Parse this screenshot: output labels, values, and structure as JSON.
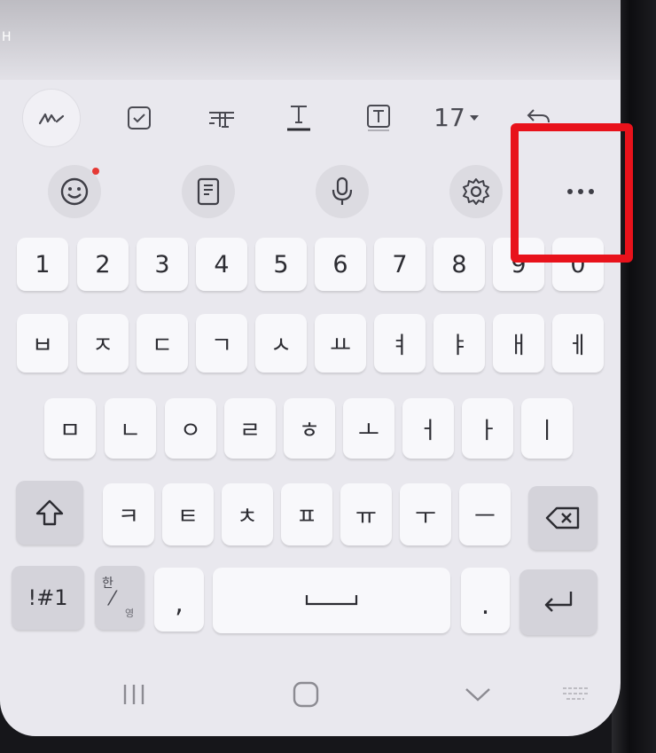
{
  "status": {
    "partial_text": "H"
  },
  "toolbar": {
    "font_size": "17"
  },
  "keyboard": {
    "row_numbers": [
      "1",
      "2",
      "3",
      "4",
      "5",
      "6",
      "7",
      "8",
      "9",
      "0"
    ],
    "row1": [
      "ㅂ",
      "ㅈ",
      "ㄷ",
      "ㄱ",
      "ㅅ",
      "ㅛ",
      "ㅕ",
      "ㅑ",
      "ㅐ",
      "ㅔ"
    ],
    "row2": [
      "ㅁ",
      "ㄴ",
      "ㅇ",
      "ㄹ",
      "ㅎ",
      "ㅗ",
      "ㅓ",
      "ㅏ",
      "ㅣ"
    ],
    "row3": [
      "ㅋ",
      "ㅌ",
      "ㅊ",
      "ㅍ",
      "ㅠ",
      "ㅜ",
      "ㅡ"
    ],
    "symbols_label": "!#1",
    "lang_top": "한",
    "lang_bottom": "영",
    "comma": ",",
    "period": "."
  },
  "annotation": {
    "color": "#e8121b"
  },
  "colors": {
    "keyboard_bg": "#e9e8ee",
    "key_bg": "#f8f8fb",
    "func_key_bg": "#d4d3da"
  }
}
